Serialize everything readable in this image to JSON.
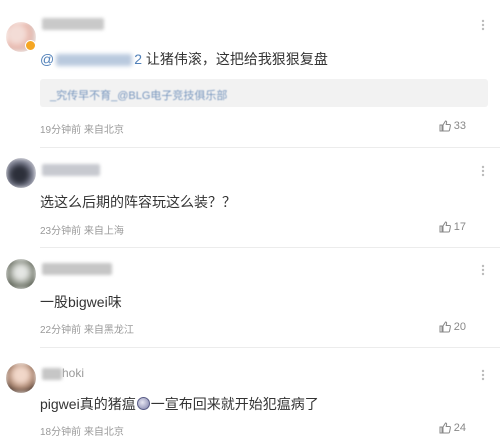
{
  "comments": [
    {
      "username": "",
      "mention": "@",
      "mention_tail": "2",
      "text": " 让猪伟滚，这把给我狠狠复盘",
      "quote": "_究传早不育_@BLG电子竞技俱乐部",
      "time": "19分钟前",
      "location": "来自北京",
      "likes": "33"
    },
    {
      "username": "",
      "text": "选这么后期的阵容玩这么装？？",
      "time": "23分钟前",
      "location": "来自上海",
      "likes": "17"
    },
    {
      "username": "",
      "text": "一股bigwei味",
      "time": "22分钟前",
      "location": "来自黑龙江",
      "likes": "20"
    },
    {
      "username_suffix": "hoki",
      "text_before": "pigwei真的猪瘟",
      "text_after": "一宣布回来就开始犯瘟病了",
      "time": "18分钟前",
      "location": "来自北京",
      "likes": "24"
    }
  ],
  "icons": {
    "like": "thumbs-up-icon",
    "more": "more-icon",
    "verified": "verified-badge-icon"
  },
  "colors": {
    "link": "#4f7fb8",
    "meta": "#9a9a9a",
    "badge": "#f5a623"
  }
}
